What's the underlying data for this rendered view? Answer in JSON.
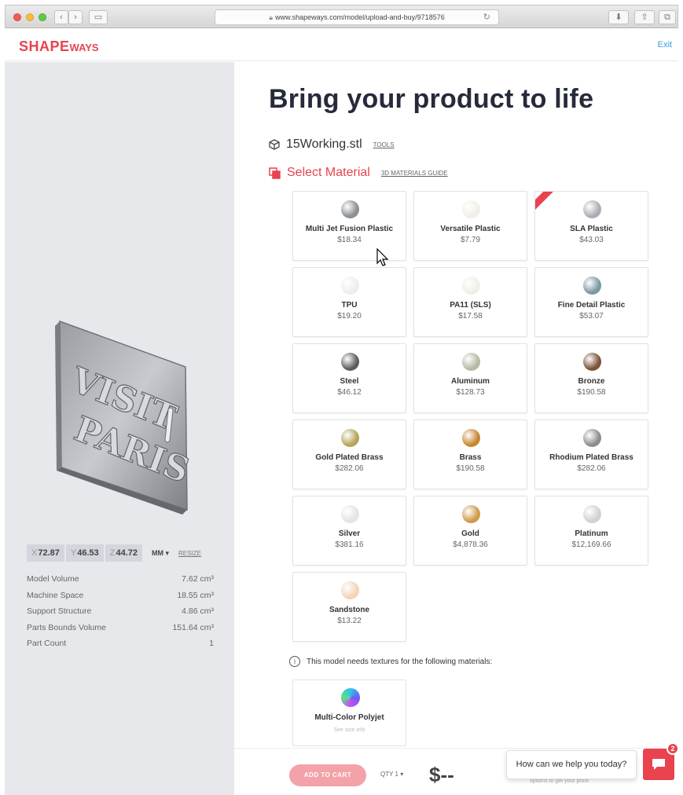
{
  "browser": {
    "url": "www.shapeways.com/model/upload-and-buy/9718576"
  },
  "header": {
    "logo_main": "SHAPE",
    "logo_small": "WAYS",
    "exit_label": "Exit"
  },
  "viewer": {
    "dims": [
      {
        "axis": "X",
        "value": "72.87"
      },
      {
        "axis": "Y",
        "value": "46.53"
      },
      {
        "axis": "Z",
        "value": "44.72"
      }
    ],
    "unit": "MM ▾",
    "resize_label": "RESIZE",
    "stats": [
      {
        "label": "Model Volume",
        "value": "7.62 cm³"
      },
      {
        "label": "Machine Space",
        "value": "18.55 cm³"
      },
      {
        "label": "Support Structure",
        "value": "4.86 cm³"
      },
      {
        "label": "Parts Bounds Volume",
        "value": "151.64 cm³"
      },
      {
        "label": "Part Count",
        "value": "1"
      }
    ]
  },
  "main": {
    "title": "Bring your product to life",
    "file_name": "15Working.stl",
    "tools_label": "TOOLS",
    "select_material_label": "Select Material",
    "guide_label": "3D MATERIALS GUIDE",
    "materials": [
      {
        "name": "Multi Jet Fusion Plastic",
        "price": "$18.34",
        "color": "#8a8f94"
      },
      {
        "name": "Versatile Plastic",
        "price": "$7.79",
        "color": "#f1efe8"
      },
      {
        "name": "SLA Plastic",
        "price": "$43.03",
        "color": "#a9adb3"
      },
      {
        "name": "TPU",
        "price": "$19.20",
        "color": "#ededed"
      },
      {
        "name": "PA11 (SLS)",
        "price": "$17.58",
        "color": "#f0eee8"
      },
      {
        "name": "Fine Detail Plastic",
        "price": "$53.07",
        "color": "#7b97a3"
      },
      {
        "name": "Steel",
        "price": "$46.12",
        "color": "#5d5b5e"
      },
      {
        "name": "Aluminum",
        "price": "$128.73",
        "color": "#b7b9a4"
      },
      {
        "name": "Bronze",
        "price": "$190.58",
        "color": "#7a5338"
      },
      {
        "name": "Gold Plated Brass",
        "price": "$282.06",
        "color": "#b6a45a"
      },
      {
        "name": "Brass",
        "price": "$190.58",
        "color": "#c7862e"
      },
      {
        "name": "Rhodium Plated Brass",
        "price": "$282.06",
        "color": "#8a8c8f"
      },
      {
        "name": "Silver",
        "price": "$381.16",
        "color": "#e4e4e4"
      },
      {
        "name": "Gold",
        "price": "$4,878.36",
        "color": "#cf9a4a"
      },
      {
        "name": "Platinum",
        "price": "$12,169.66",
        "color": "#cfd2cf"
      },
      {
        "name": "Sandstone",
        "price": "$13.22",
        "color": "#f3d3b8"
      }
    ],
    "texture_notice": "This model needs textures for the following materials:",
    "texture_material": {
      "name": "Multi-Color Polyjet",
      "sub": "See size info"
    }
  },
  "footer": {
    "add_to_cart": "ADD TO CART",
    "qty_label": "QTY  1  ▾",
    "price": "$--",
    "hint": "options to get your price."
  },
  "chat": {
    "bubble": "How can we help you today?",
    "badge": "2"
  },
  "colors": {
    "brand": "#e8434f",
    "link": "#3b9fd6",
    "title": "#262b3a"
  }
}
